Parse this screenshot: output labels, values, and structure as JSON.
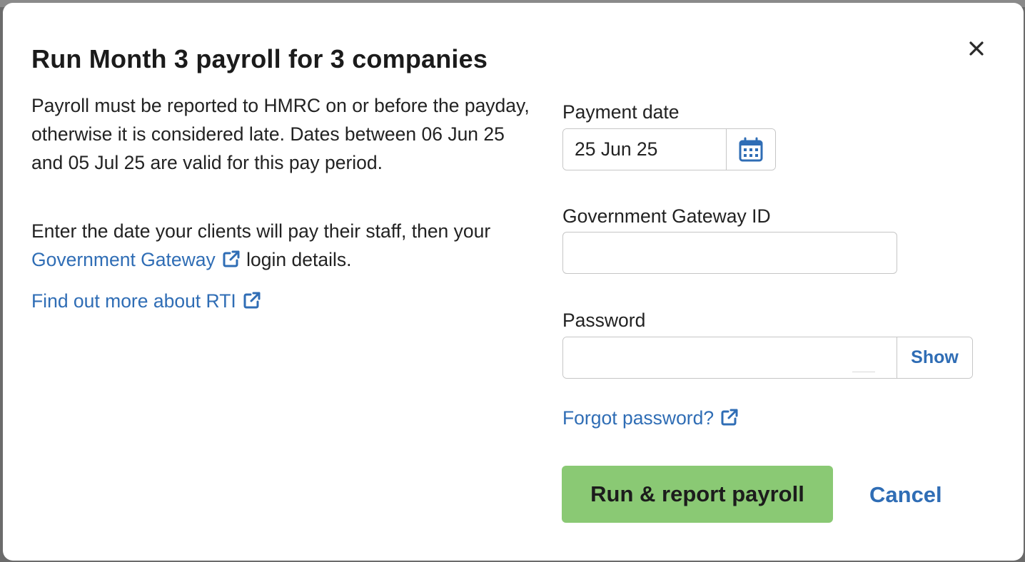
{
  "dialog": {
    "title": "Run Month 3 payroll for 3 companies",
    "description": "Payroll must be reported to HMRC on or before the payday, otherwise it is considered late. Dates between 06 Jun 25 and 05 Jul 25 are valid for this pay period.",
    "instruction_prefix": "Enter the date your clients will pay their staff, then your",
    "gateway_link_label": "Government Gateway",
    "instruction_suffix": "login details.",
    "rti_link_label": "Find out more about RTI",
    "close_icon": "close-icon"
  },
  "form": {
    "payment_date_label": "Payment date",
    "payment_date_value": "25 Jun 25",
    "calendar_icon": "calendar-icon",
    "gateway_id_label": "Government Gateway ID",
    "gateway_id_value": "",
    "password_label": "Password",
    "password_value": "",
    "show_label": "Show",
    "forgot_link_label": "Forgot password?"
  },
  "actions": {
    "run_label": "Run & report payroll",
    "cancel_label": "Cancel"
  },
  "colors": {
    "link": "#2f6db5",
    "primary_button": "#8ac974",
    "input_border": "#c6c6c6"
  }
}
